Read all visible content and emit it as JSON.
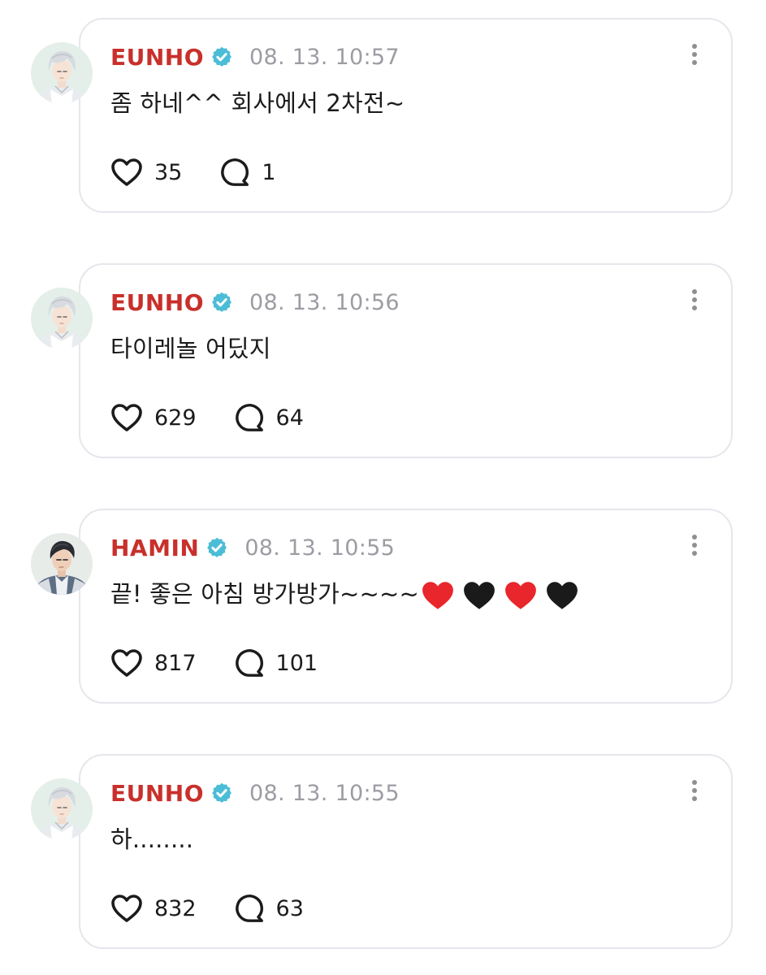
{
  "colors": {
    "author": "#c8302b",
    "verified_badge": "#4cbdd6",
    "timestamp": "#9c9ca3",
    "card_border": "#e6e6ec",
    "text": "#1b1b1b",
    "red_heart": "#e8262b",
    "black_heart": "#1a1a1a"
  },
  "icons": {
    "verified": "verified-badge-icon",
    "like": "heart-outline-icon",
    "comment": "comment-bubble-icon",
    "more": "more-vertical-icon"
  },
  "posts": [
    {
      "author": "EUNHO",
      "timestamp": "08. 13. 10:57",
      "text": "좀 하네^^ 회사에서 2차전~",
      "likes": "35",
      "comments": "1",
      "emojis": []
    },
    {
      "author": "EUNHO",
      "timestamp": "08. 13. 10:56",
      "text": "타이레놀 어딨지",
      "likes": "629",
      "comments": "64",
      "emojis": []
    },
    {
      "author": "HAMIN",
      "timestamp": "08. 13. 10:55",
      "text": "끝! 좋은 아침 방가방가~~~~",
      "likes": "817",
      "comments": "101",
      "emojis": [
        "red-heart",
        "black-heart",
        "red-heart",
        "black-heart"
      ]
    },
    {
      "author": "EUNHO",
      "timestamp": "08. 13. 10:55",
      "text": "하........",
      "likes": "832",
      "comments": "63",
      "emojis": []
    }
  ]
}
